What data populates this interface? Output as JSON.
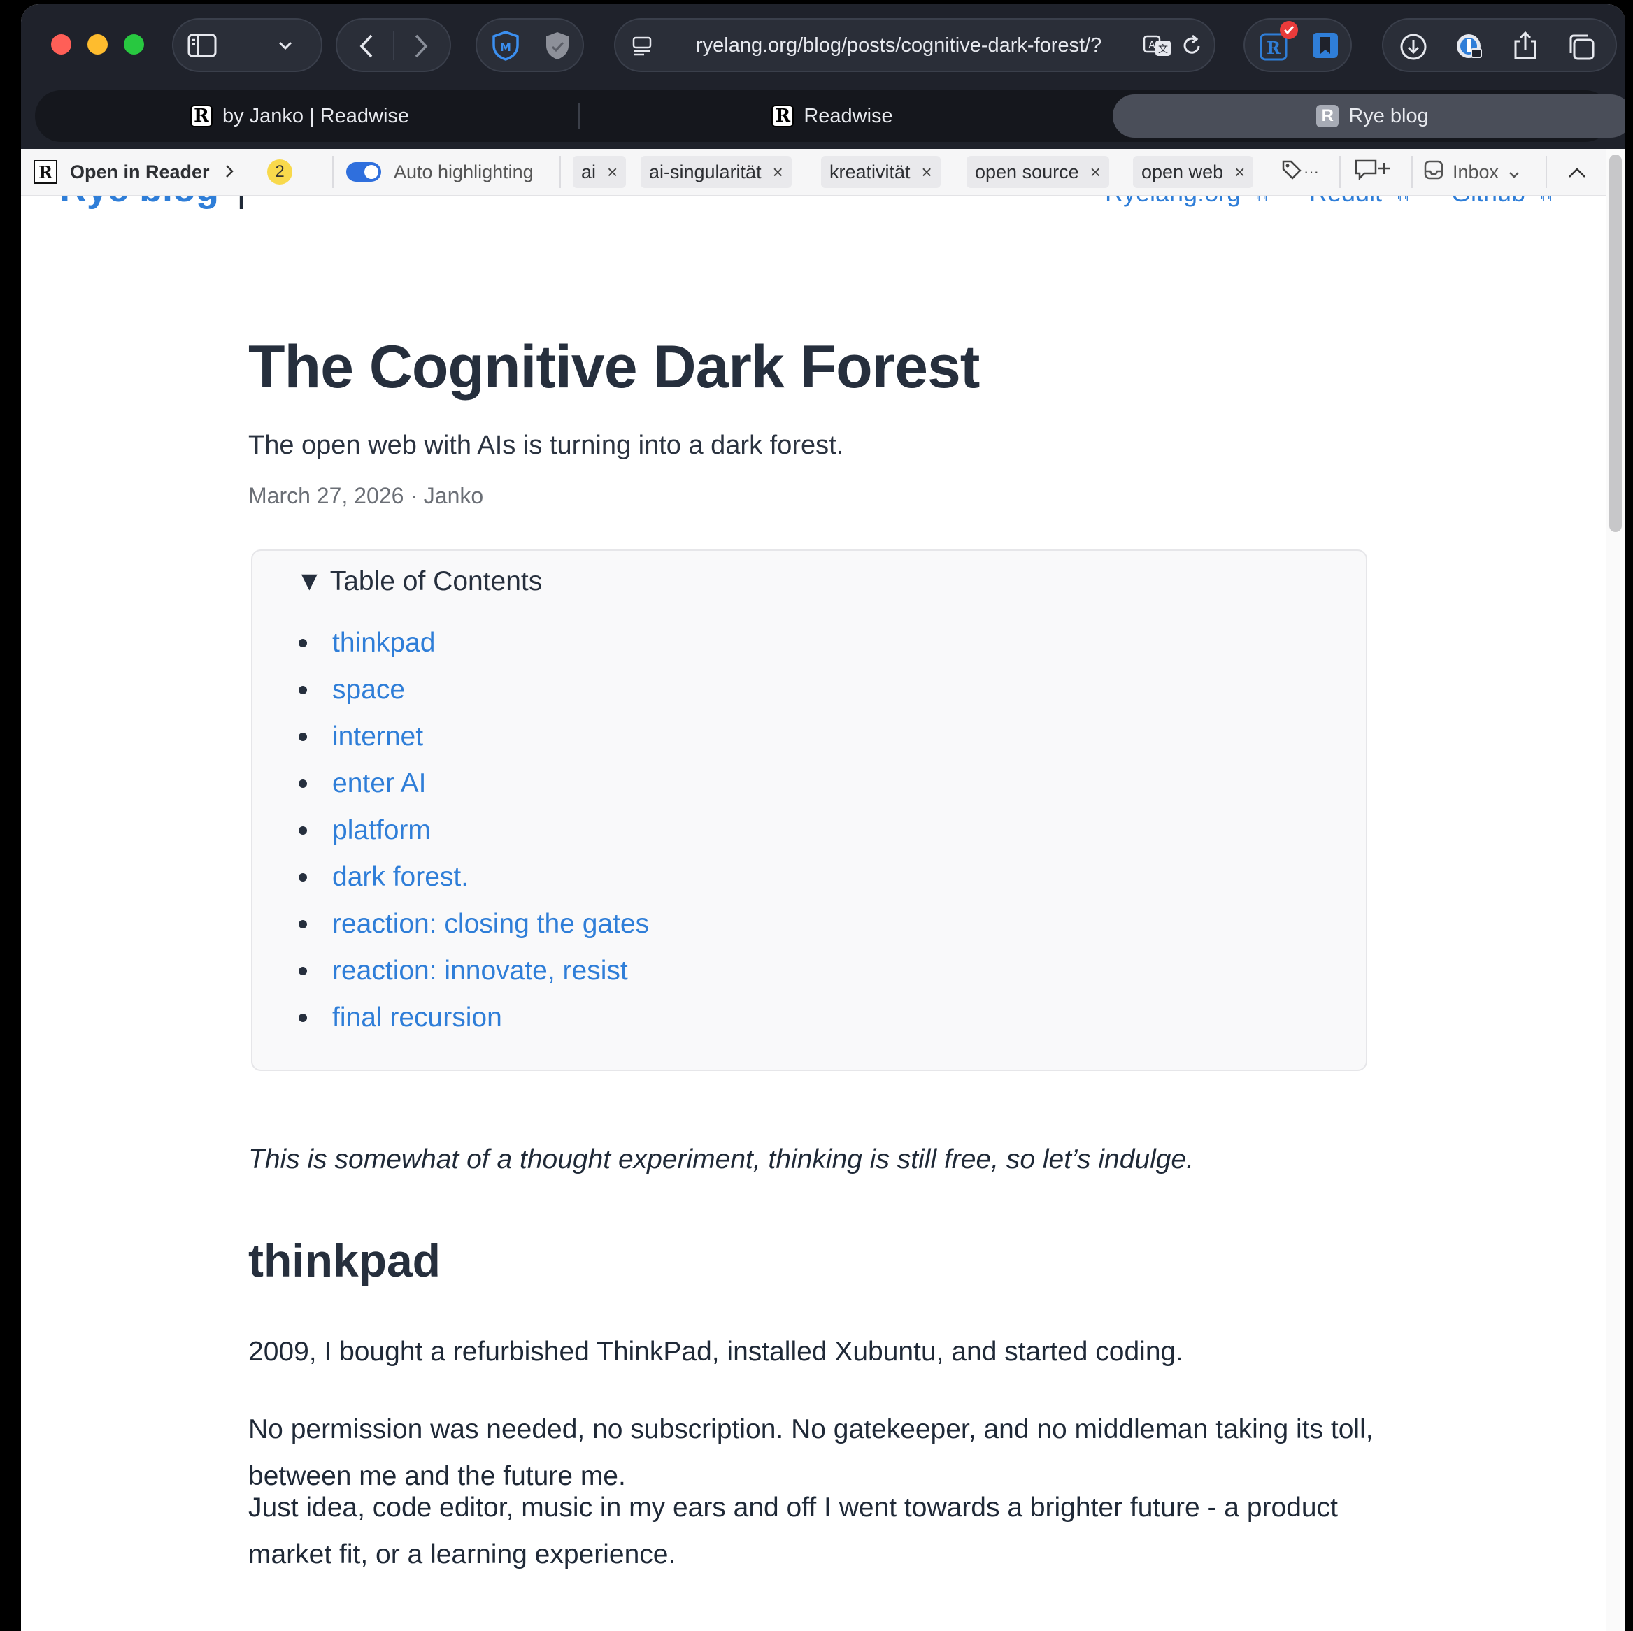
{
  "browser": {
    "address": "ryelang.org/blog/posts/cognitive-dark-forest/?",
    "extension_badge_icon": "check-badge",
    "tabs": [
      {
        "label": "by Janko | Readwise",
        "icon": "R",
        "active": false
      },
      {
        "label": "Readwise",
        "icon": "R",
        "active": false
      },
      {
        "label": "Rye blog",
        "icon": "R",
        "active": true
      }
    ]
  },
  "readwise_bar": {
    "open_label": "Open in Reader",
    "count": "2",
    "auto_highlight_label": "Auto highlighting",
    "tags": [
      {
        "label": "ai"
      },
      {
        "label": "ai-singularität"
      },
      {
        "label": "kreativität"
      },
      {
        "label": "open source"
      },
      {
        "label": "open web"
      }
    ],
    "tag_more": "···",
    "inbox_label": "Inbox"
  },
  "site": {
    "title": "Rye blog",
    "nav": [
      {
        "label": "Ryelang.org"
      },
      {
        "label": "Reddit"
      },
      {
        "label": "Github"
      }
    ]
  },
  "post": {
    "title": "The Cognitive Dark Forest",
    "description": "The open web with AIs is turning into a dark forest.",
    "meta": "March 27, 2026 · Janko",
    "toc_title": "▼ Table of Contents",
    "toc": [
      "thinkpad",
      "space",
      "internet",
      "enter AI",
      "platform",
      "dark forest.",
      "reaction: closing the gates",
      "reaction: innovate, resist",
      "final recursion"
    ],
    "intro": "This is somewhat of a thought experiment, thinking is still free, so let’s indulge.",
    "section_heading": "thinkpad",
    "paragraphs": [
      "2009, I bought a refurbished ThinkPad, installed Xubuntu, and started coding.",
      "No permission was needed, no subscription. No gatekeeper, and no middleman taking its toll, between me and the future me.",
      "Just idea, code editor, music in my ears and off I went towards a brighter future - a product market fit, or a learning experience."
    ]
  },
  "colors": {
    "link": "#2f7ed8",
    "heading": "#262f3d",
    "chrome": "#1f222b"
  }
}
